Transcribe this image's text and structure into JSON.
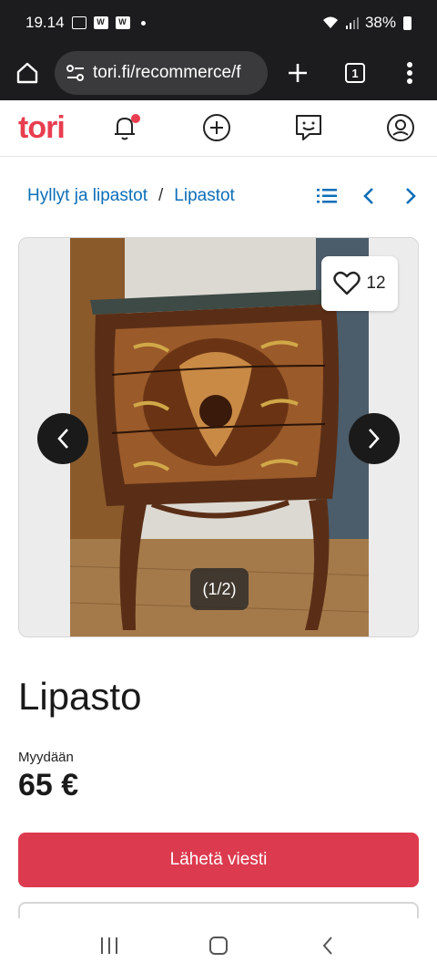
{
  "status_bar": {
    "time": "19.14",
    "battery": "38%",
    "icons": [
      "gallery-icon",
      "w-app-icon",
      "w-app-icon",
      "dot-icon",
      "wifi-icon",
      "signal-icon",
      "battery-icon"
    ]
  },
  "browser": {
    "url": "tori.fi/recommerce/f",
    "tab_count": "1",
    "icons": [
      "home-icon",
      "site-settings-icon",
      "plus-icon",
      "tabs-icon",
      "more-vert-icon"
    ]
  },
  "header": {
    "logo": "tori",
    "icons": [
      "bell-icon",
      "add-circle-icon",
      "messages-icon",
      "profile-icon"
    ],
    "accent": "#e83e4f"
  },
  "breadcrumb": {
    "items": [
      "Hyllyt ja lipastot",
      "Lipastot"
    ],
    "separator": "/",
    "tools": [
      "list-icon",
      "chevron-left-icon",
      "chevron-right-icon"
    ]
  },
  "gallery": {
    "favorite_count": "12",
    "counter": "(1/2)",
    "icons": [
      "heart-icon",
      "prev-arrow-icon",
      "next-arrow-icon"
    ]
  },
  "listing": {
    "title": "Lipasto",
    "trade_type": "Myydään",
    "price": "65 €",
    "message_button": "Lähetä viesti"
  },
  "colors": {
    "primary": "#dc3a4e",
    "link": "#0d6eb8",
    "dark_bar": "#1c1c1e"
  },
  "system_nav": [
    "recents-icon",
    "home-icon",
    "back-icon"
  ]
}
